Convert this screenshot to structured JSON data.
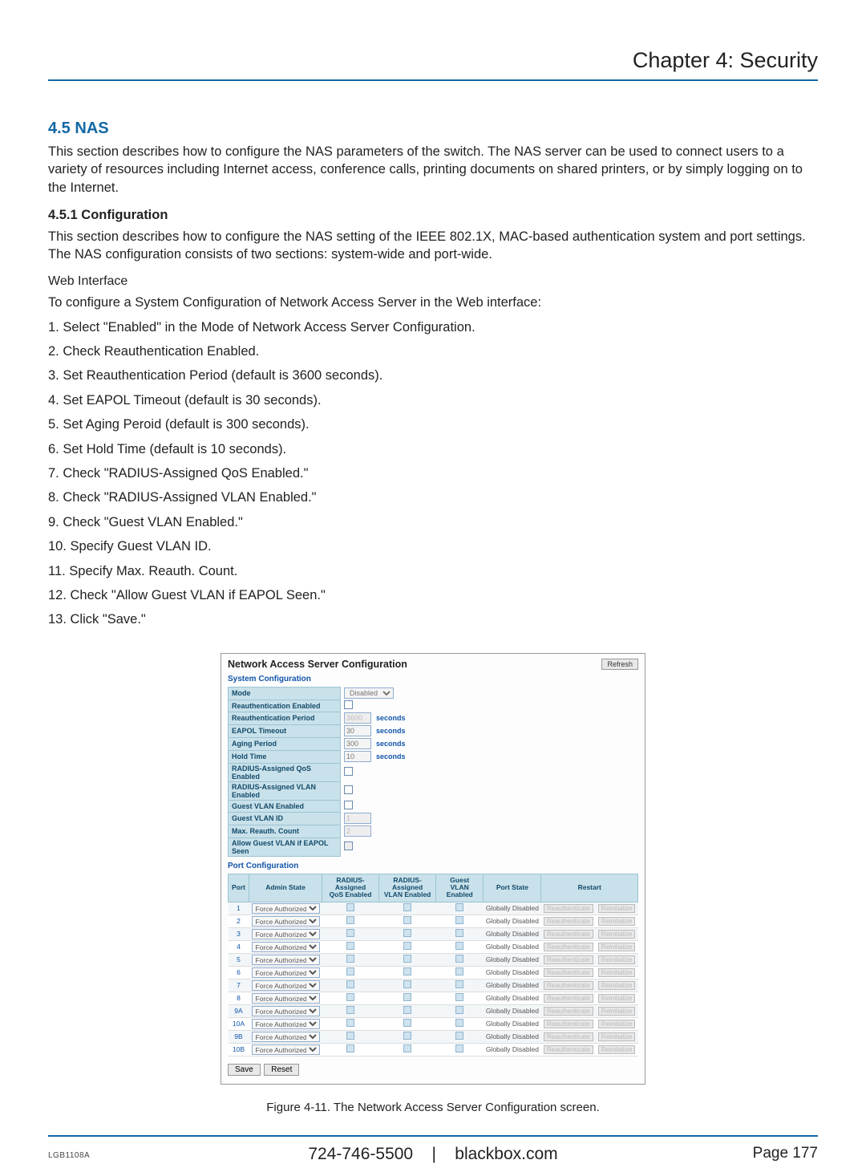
{
  "chapter_header": "Chapter 4: Security",
  "section": {
    "number": "4.5",
    "title": "NAS"
  },
  "intro": "This section describes how to configure the NAS parameters of the switch. The NAS server can be used to connect users to a variety of resources including Internet access, conference calls, printing documents on shared printers, or by simply logging on to the Internet.",
  "sub1": {
    "heading": "4.5.1 Configuration",
    "text": "This section describes how to configure the NAS setting of the IEEE 802.1X, MAC-based authentication system and port settings. The NAS configuration consists of two sections: system-wide and port-wide."
  },
  "web_heading": "Web Interface",
  "web_intro": "To configure a System Configuration of Network Access Server in the Web interface:",
  "steps": [
    "1. Select \"Enabled\" in the Mode of Network Access Server Configuration.",
    "2. Check Reauthentication Enabled.",
    "3. Set Reauthentication Period (default is 3600 seconds).",
    "4. Set EAPOL Timeout (default is 30 seconds).",
    "5. Set Aging Peroid (default is 300 seconds).",
    "6. Set Hold Time (default is 10 seconds).",
    "7. Check \"RADIUS-Assigned QoS Enabled.\"",
    "8. Check \"RADIUS-Assigned VLAN Enabled.\"",
    "9. Check \"Guest VLAN Enabled.\"",
    "10. Specify Guest VLAN ID.",
    "11. Specify Max. Reauth. Count.",
    "12. Check \"Allow Guest VLAN if EAPOL Seen.\"",
    "13. Click \"Save.\""
  ],
  "panel": {
    "title": "Network Access Server Configuration",
    "refresh": "Refresh",
    "sys_title": "System Configuration",
    "rows": [
      {
        "label": "Mode",
        "type": "select",
        "value": "Disabled"
      },
      {
        "label": "Reauthentication Enabled",
        "type": "check"
      },
      {
        "label": "Reauthentication Period",
        "type": "input",
        "value": "3600",
        "unit": "seconds",
        "disabled": true
      },
      {
        "label": "EAPOL Timeout",
        "type": "input",
        "value": "30",
        "unit": "seconds"
      },
      {
        "label": "Aging Period",
        "type": "input",
        "value": "300",
        "unit": "seconds"
      },
      {
        "label": "Hold Time",
        "type": "input",
        "value": "10",
        "unit": "seconds"
      },
      {
        "label": "RADIUS-Assigned QoS Enabled",
        "type": "check"
      },
      {
        "label": "RADIUS-Assigned VLAN Enabled",
        "type": "check"
      },
      {
        "label": "Guest VLAN Enabled",
        "type": "check"
      },
      {
        "label": "Guest VLAN ID",
        "type": "input",
        "value": "1",
        "disabled": true
      },
      {
        "label": "Max. Reauth. Count",
        "type": "input",
        "value": "2",
        "disabled": true
      },
      {
        "label": "Allow Guest VLAN if EAPOL Seen",
        "type": "check",
        "disabled": true
      }
    ],
    "port_title": "Port Configuration",
    "port_headers": [
      "Port",
      "Admin State",
      "RADIUS-Assigned\nQoS Enabled",
      "RADIUS-Assigned\nVLAN Enabled",
      "Guest\nVLAN Enabled",
      "Port State",
      "Restart"
    ],
    "ports": [
      "1",
      "2",
      "3",
      "4",
      "5",
      "6",
      "7",
      "8",
      "9A",
      "10A",
      "9B",
      "10B"
    ],
    "admin_state": "Force Authorized",
    "port_state": "Globally Disabled",
    "reauth_btn": "Reauthenticate",
    "reinit_btn": "Reinitialize",
    "save": "Save",
    "reset": "Reset"
  },
  "caption": "Figure 4-11. The Network Access Server Configuration screen.",
  "footer": {
    "left": "LGB1108A",
    "center_phone": "724-746-5500",
    "center_sep": "|",
    "center_site": "blackbox.com",
    "right": "Page 177"
  }
}
